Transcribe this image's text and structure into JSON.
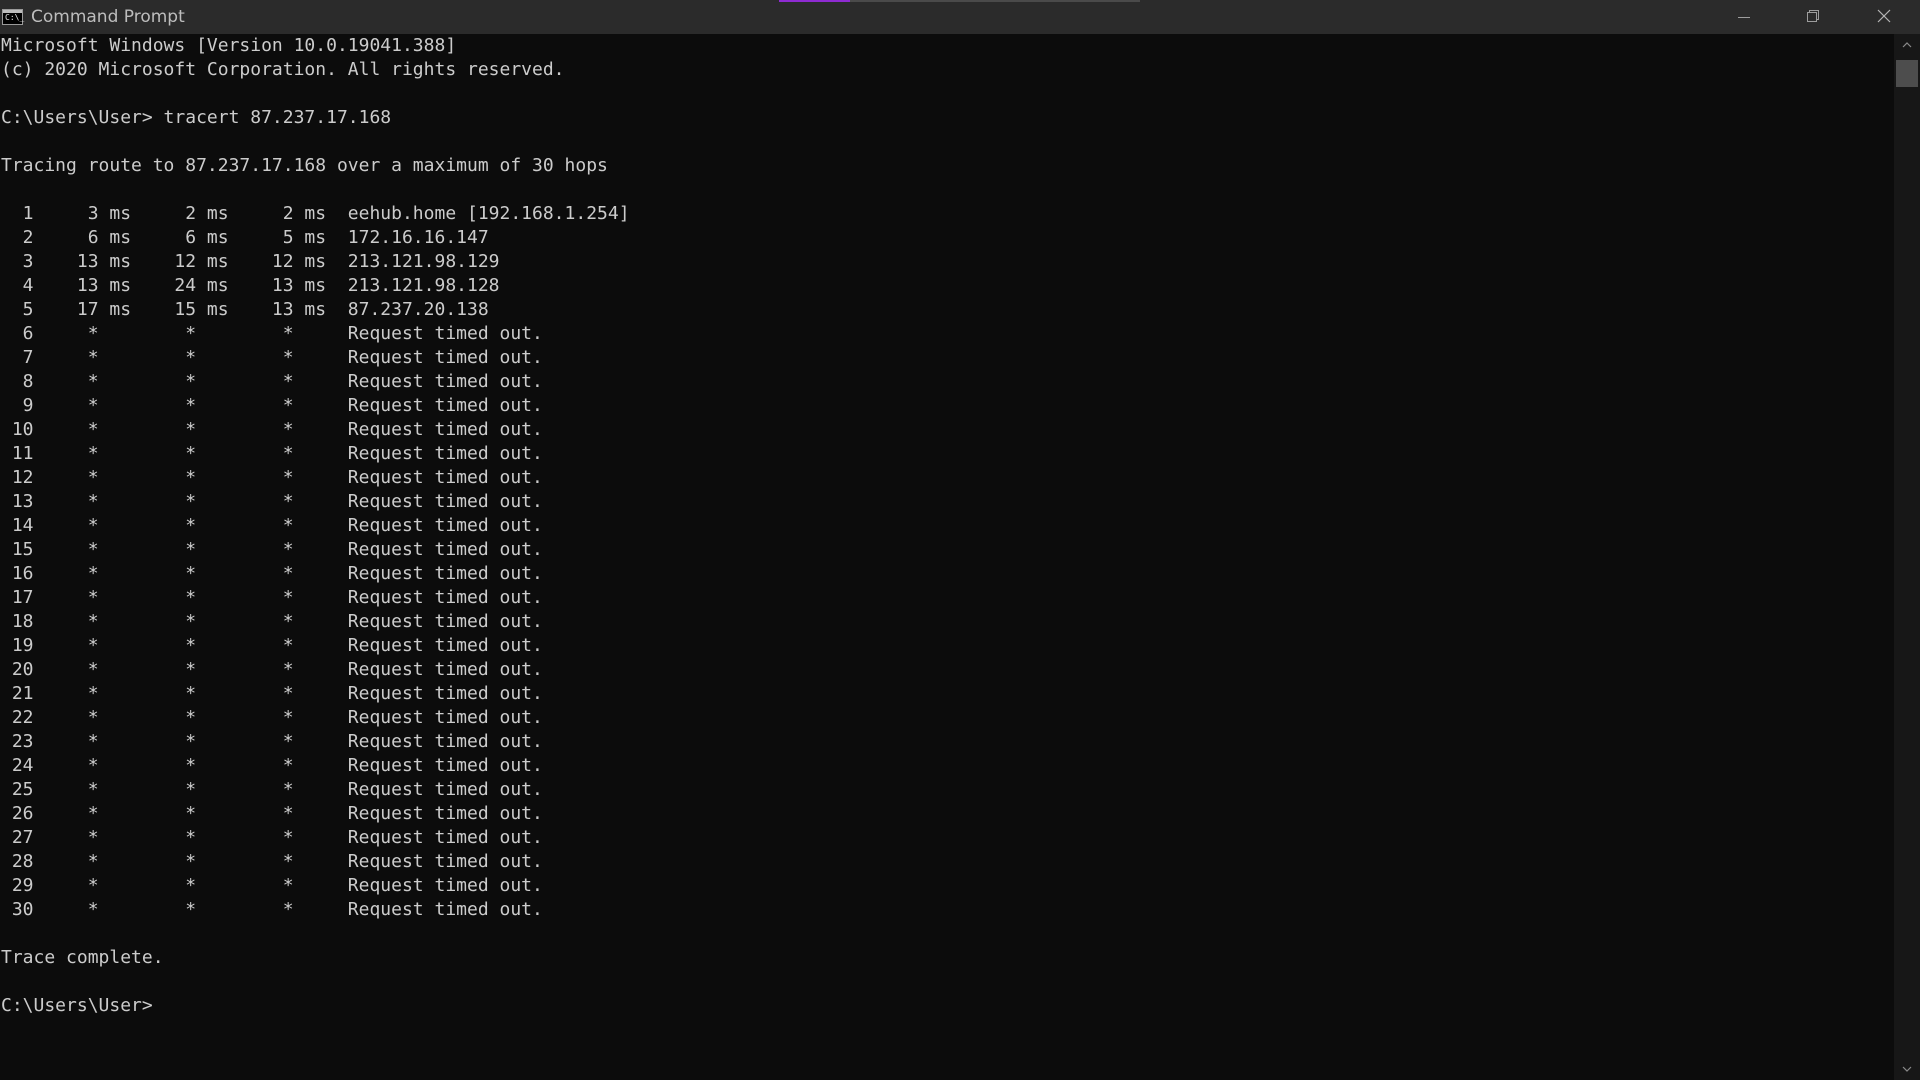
{
  "window": {
    "title": "Command Prompt",
    "accent_color": "#8e2bd1",
    "background_color": "#0c0c0c",
    "text_color": "#cccccc"
  },
  "controls": {
    "minimize_icon": "minimize-icon",
    "maximize_icon": "restore-icon",
    "close_icon": "close-icon"
  },
  "console": {
    "lines": [
      "Microsoft Windows [Version 10.0.19041.388]",
      "(c) 2020 Microsoft Corporation. All rights reserved.",
      "",
      "C:\\Users\\User> tracert 87.237.17.168",
      "",
      "Tracing route to 87.237.17.168 over a maximum of 30 hops",
      "",
      "  1     3 ms     2 ms     2 ms  eehub.home [192.168.1.254]",
      "  2     6 ms     6 ms     5 ms  172.16.16.147",
      "  3    13 ms    12 ms    12 ms  213.121.98.129",
      "  4    13 ms    24 ms    13 ms  213.121.98.128",
      "  5    17 ms    15 ms    13 ms  87.237.20.138",
      "  6     *        *        *     Request timed out.",
      "  7     *        *        *     Request timed out.",
      "  8     *        *        *     Request timed out.",
      "  9     *        *        *     Request timed out.",
      " 10     *        *        *     Request timed out.",
      " 11     *        *        *     Request timed out.",
      " 12     *        *        *     Request timed out.",
      " 13     *        *        *     Request timed out.",
      " 14     *        *        *     Request timed out.",
      " 15     *        *        *     Request timed out.",
      " 16     *        *        *     Request timed out.",
      " 17     *        *        *     Request timed out.",
      " 18     *        *        *     Request timed out.",
      " 19     *        *        *     Request timed out.",
      " 20     *        *        *     Request timed out.",
      " 21     *        *        *     Request timed out.",
      " 22     *        *        *     Request timed out.",
      " 23     *        *        *     Request timed out.",
      " 24     *        *        *     Request timed out.",
      " 25     *        *        *     Request timed out.",
      " 26     *        *        *     Request timed out.",
      " 27     *        *        *     Request timed out.",
      " 28     *        *        *     Request timed out.",
      " 29     *        *        *     Request timed out.",
      " 30     *        *        *     Request timed out.",
      "",
      "Trace complete.",
      "",
      "C:\\Users\\User>"
    ]
  }
}
